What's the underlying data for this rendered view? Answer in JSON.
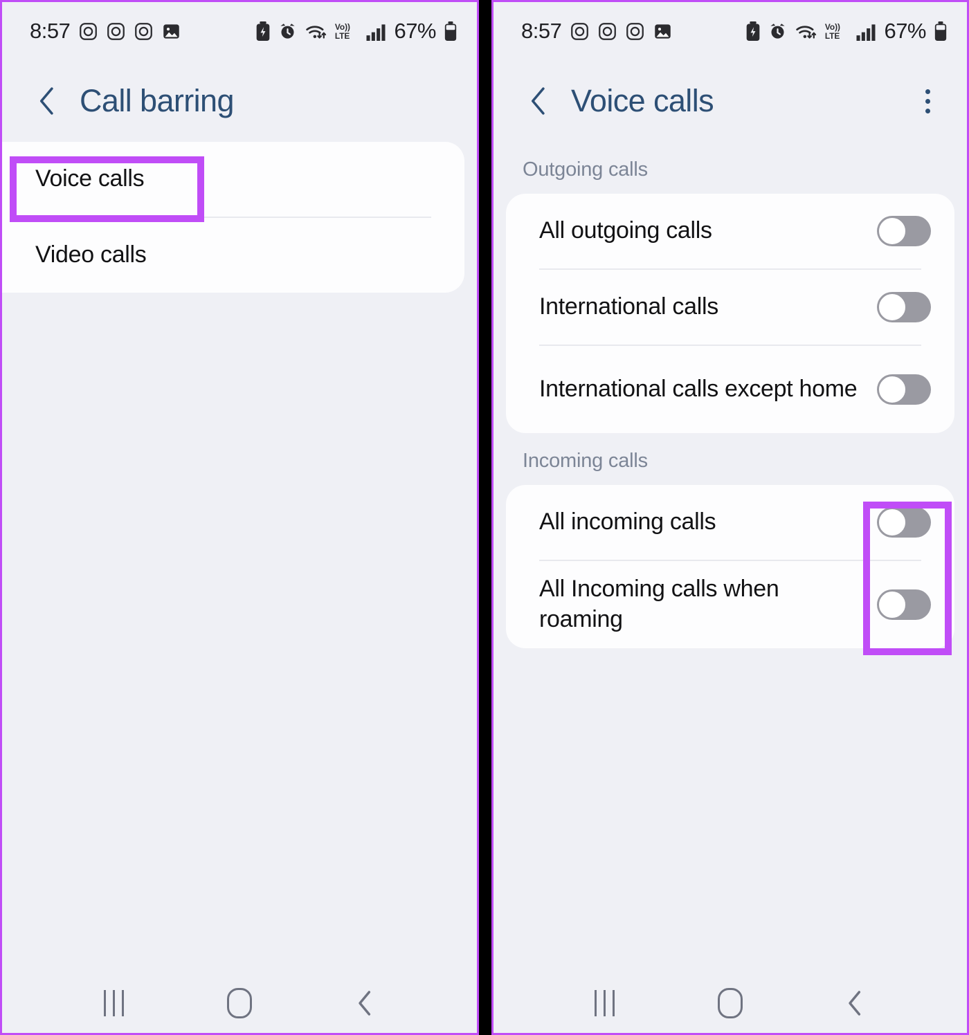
{
  "status_bar": {
    "time": "8:57",
    "battery_percent": "67%",
    "left_icons": [
      "camera-icon",
      "camera-icon",
      "camera-icon",
      "gallery-icon"
    ],
    "right_icons": [
      "battery-saver-icon",
      "alarm-icon",
      "wifi-icon",
      "volte-lte-icon",
      "signal-bars-icon",
      "battery-icon"
    ],
    "volte_label": "Vo)) LTE"
  },
  "left_screen": {
    "header": {
      "back": "back-chevron",
      "title": "Call barring"
    },
    "items": [
      {
        "label": "Voice calls",
        "highlighted": true
      },
      {
        "label": "Video calls",
        "highlighted": false
      }
    ]
  },
  "right_screen": {
    "header": {
      "back": "back-chevron",
      "title": "Voice calls",
      "menu": "more-options"
    },
    "sections": [
      {
        "title": "Outgoing calls",
        "rows": [
          {
            "label": "All outgoing calls",
            "toggle": "off"
          },
          {
            "label": "International calls",
            "toggle": "off"
          },
          {
            "label": "International calls except home",
            "toggle": "off"
          }
        ]
      },
      {
        "title": "Incoming calls",
        "rows": [
          {
            "label": "All incoming calls",
            "toggle": "off"
          },
          {
            "label": "All Incoming calls when roaming",
            "toggle": "off"
          }
        ]
      }
    ]
  },
  "nav_bar": {
    "recents": "recents-button",
    "home": "home-button",
    "back": "back-button"
  },
  "colors": {
    "highlight": "#c04df7",
    "title": "#2d4f75",
    "background": "#eff0f5",
    "card": "#fdfdfe",
    "section_label": "#7c8596",
    "toggle_off": "#9a9aa2"
  }
}
